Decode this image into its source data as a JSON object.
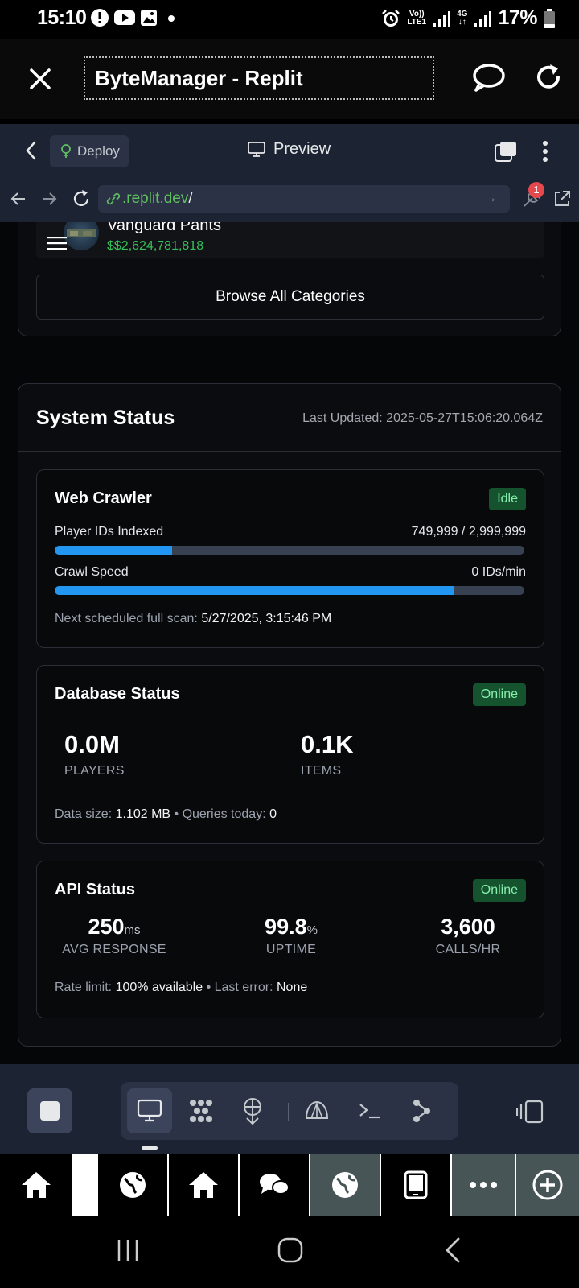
{
  "status_bar": {
    "time": "15:10",
    "network_top": "Vo))",
    "network_bottom": "LTE1",
    "data_top": "4G",
    "data_bottom": "↓↑",
    "battery": "17%"
  },
  "browser": {
    "title": "ByteManager - Replit"
  },
  "replit": {
    "deploy_label": "Deploy",
    "preview_label": "Preview",
    "url_host": ".replit.dev",
    "url_path": "/",
    "notification_count": "1"
  },
  "top_item": {
    "name": "Vanguard Pants",
    "price": "$$2,624,781,818"
  },
  "browse_label": "Browse All Categories",
  "system_status": {
    "title": "System Status",
    "last_updated": "Last Updated: 2025-05-27T15:06:20.064Z",
    "crawler": {
      "title": "Web Crawler",
      "status": "Idle",
      "indexed_label": "Player IDs Indexed",
      "indexed_value": "749,999 / 2,999,999",
      "indexed_fraction": 0.25,
      "speed_label": "Crawl Speed",
      "speed_value": "0 IDs/min",
      "speed_fraction": 0.85,
      "next_scan_label": "Next scheduled full scan:",
      "next_scan_value": "5/27/2025, 3:15:46 PM"
    },
    "database": {
      "title": "Database Status",
      "status": "Online",
      "players_value": "0.0M",
      "players_label": "PLAYERS",
      "items_value": "0.1K",
      "items_label": "ITEMS",
      "size_label": "Data size:",
      "size_value": "1.102 MB",
      "queries_label": "Queries today:",
      "queries_value": "0"
    },
    "api": {
      "title": "API Status",
      "status": "Online",
      "response_value": "250",
      "response_unit": "ms",
      "response_label": "AVG RESPONSE",
      "uptime_value": "99.8",
      "uptime_unit": "%",
      "uptime_label": "UPTIME",
      "calls_value": "3,600",
      "calls_label": "CALLS/HR",
      "rate_label": "Rate limit:",
      "rate_value": "100% available",
      "error_label": "Last error:",
      "error_value": "None"
    }
  },
  "colors": {
    "accent_blue": "#2196f3",
    "online_green": "#86efac",
    "price_green": "#37c15a",
    "replit_bg": "#1c2333"
  }
}
